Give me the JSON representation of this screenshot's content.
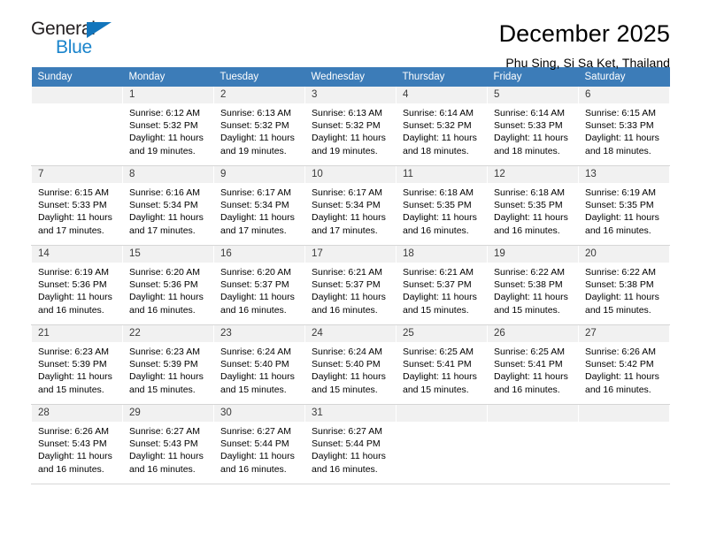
{
  "brand": {
    "name_top": "General",
    "name_bottom": "Blue",
    "triangle_color": "#1275bc",
    "blue_color": "#1a84cc"
  },
  "header": {
    "title": "December 2025",
    "subtitle": "Phu Sing, Si Sa Ket, Thailand"
  },
  "theme": {
    "header_row_bg": "#3c7cb8",
    "header_row_text": "#ffffff",
    "daynum_bg": "#f1f1f1",
    "grid_line": "#d9d9d9"
  },
  "weekdays": [
    "Sunday",
    "Monday",
    "Tuesday",
    "Wednesday",
    "Thursday",
    "Friday",
    "Saturday"
  ],
  "labels": {
    "sunrise_prefix": "Sunrise: ",
    "sunset_prefix": "Sunset: ",
    "daylight_prefix": "Daylight: "
  },
  "weeks": [
    [
      {
        "empty": true
      },
      {
        "day": "1",
        "sunrise": "Sunrise: 6:12 AM",
        "sunset": "Sunset: 5:32 PM",
        "daylight": "Daylight: 11 hours and 19 minutes."
      },
      {
        "day": "2",
        "sunrise": "Sunrise: 6:13 AM",
        "sunset": "Sunset: 5:32 PM",
        "daylight": "Daylight: 11 hours and 19 minutes."
      },
      {
        "day": "3",
        "sunrise": "Sunrise: 6:13 AM",
        "sunset": "Sunset: 5:32 PM",
        "daylight": "Daylight: 11 hours and 19 minutes."
      },
      {
        "day": "4",
        "sunrise": "Sunrise: 6:14 AM",
        "sunset": "Sunset: 5:32 PM",
        "daylight": "Daylight: 11 hours and 18 minutes."
      },
      {
        "day": "5",
        "sunrise": "Sunrise: 6:14 AM",
        "sunset": "Sunset: 5:33 PM",
        "daylight": "Daylight: 11 hours and 18 minutes."
      },
      {
        "day": "6",
        "sunrise": "Sunrise: 6:15 AM",
        "sunset": "Sunset: 5:33 PM",
        "daylight": "Daylight: 11 hours and 18 minutes."
      }
    ],
    [
      {
        "day": "7",
        "sunrise": "Sunrise: 6:15 AM",
        "sunset": "Sunset: 5:33 PM",
        "daylight": "Daylight: 11 hours and 17 minutes."
      },
      {
        "day": "8",
        "sunrise": "Sunrise: 6:16 AM",
        "sunset": "Sunset: 5:34 PM",
        "daylight": "Daylight: 11 hours and 17 minutes."
      },
      {
        "day": "9",
        "sunrise": "Sunrise: 6:17 AM",
        "sunset": "Sunset: 5:34 PM",
        "daylight": "Daylight: 11 hours and 17 minutes."
      },
      {
        "day": "10",
        "sunrise": "Sunrise: 6:17 AM",
        "sunset": "Sunset: 5:34 PM",
        "daylight": "Daylight: 11 hours and 17 minutes."
      },
      {
        "day": "11",
        "sunrise": "Sunrise: 6:18 AM",
        "sunset": "Sunset: 5:35 PM",
        "daylight": "Daylight: 11 hours and 16 minutes."
      },
      {
        "day": "12",
        "sunrise": "Sunrise: 6:18 AM",
        "sunset": "Sunset: 5:35 PM",
        "daylight": "Daylight: 11 hours and 16 minutes."
      },
      {
        "day": "13",
        "sunrise": "Sunrise: 6:19 AM",
        "sunset": "Sunset: 5:35 PM",
        "daylight": "Daylight: 11 hours and 16 minutes."
      }
    ],
    [
      {
        "day": "14",
        "sunrise": "Sunrise: 6:19 AM",
        "sunset": "Sunset: 5:36 PM",
        "daylight": "Daylight: 11 hours and 16 minutes."
      },
      {
        "day": "15",
        "sunrise": "Sunrise: 6:20 AM",
        "sunset": "Sunset: 5:36 PM",
        "daylight": "Daylight: 11 hours and 16 minutes."
      },
      {
        "day": "16",
        "sunrise": "Sunrise: 6:20 AM",
        "sunset": "Sunset: 5:37 PM",
        "daylight": "Daylight: 11 hours and 16 minutes."
      },
      {
        "day": "17",
        "sunrise": "Sunrise: 6:21 AM",
        "sunset": "Sunset: 5:37 PM",
        "daylight": "Daylight: 11 hours and 16 minutes."
      },
      {
        "day": "18",
        "sunrise": "Sunrise: 6:21 AM",
        "sunset": "Sunset: 5:37 PM",
        "daylight": "Daylight: 11 hours and 15 minutes."
      },
      {
        "day": "19",
        "sunrise": "Sunrise: 6:22 AM",
        "sunset": "Sunset: 5:38 PM",
        "daylight": "Daylight: 11 hours and 15 minutes."
      },
      {
        "day": "20",
        "sunrise": "Sunrise: 6:22 AM",
        "sunset": "Sunset: 5:38 PM",
        "daylight": "Daylight: 11 hours and 15 minutes."
      }
    ],
    [
      {
        "day": "21",
        "sunrise": "Sunrise: 6:23 AM",
        "sunset": "Sunset: 5:39 PM",
        "daylight": "Daylight: 11 hours and 15 minutes."
      },
      {
        "day": "22",
        "sunrise": "Sunrise: 6:23 AM",
        "sunset": "Sunset: 5:39 PM",
        "daylight": "Daylight: 11 hours and 15 minutes."
      },
      {
        "day": "23",
        "sunrise": "Sunrise: 6:24 AM",
        "sunset": "Sunset: 5:40 PM",
        "daylight": "Daylight: 11 hours and 15 minutes."
      },
      {
        "day": "24",
        "sunrise": "Sunrise: 6:24 AM",
        "sunset": "Sunset: 5:40 PM",
        "daylight": "Daylight: 11 hours and 15 minutes."
      },
      {
        "day": "25",
        "sunrise": "Sunrise: 6:25 AM",
        "sunset": "Sunset: 5:41 PM",
        "daylight": "Daylight: 11 hours and 15 minutes."
      },
      {
        "day": "26",
        "sunrise": "Sunrise: 6:25 AM",
        "sunset": "Sunset: 5:41 PM",
        "daylight": "Daylight: 11 hours and 16 minutes."
      },
      {
        "day": "27",
        "sunrise": "Sunrise: 6:26 AM",
        "sunset": "Sunset: 5:42 PM",
        "daylight": "Daylight: 11 hours and 16 minutes."
      }
    ],
    [
      {
        "day": "28",
        "sunrise": "Sunrise: 6:26 AM",
        "sunset": "Sunset: 5:43 PM",
        "daylight": "Daylight: 11 hours and 16 minutes."
      },
      {
        "day": "29",
        "sunrise": "Sunrise: 6:27 AM",
        "sunset": "Sunset: 5:43 PM",
        "daylight": "Daylight: 11 hours and 16 minutes."
      },
      {
        "day": "30",
        "sunrise": "Sunrise: 6:27 AM",
        "sunset": "Sunset: 5:44 PM",
        "daylight": "Daylight: 11 hours and 16 minutes."
      },
      {
        "day": "31",
        "sunrise": "Sunrise: 6:27 AM",
        "sunset": "Sunset: 5:44 PM",
        "daylight": "Daylight: 11 hours and 16 minutes."
      },
      {
        "empty": true
      },
      {
        "empty": true
      },
      {
        "empty": true
      }
    ]
  ]
}
